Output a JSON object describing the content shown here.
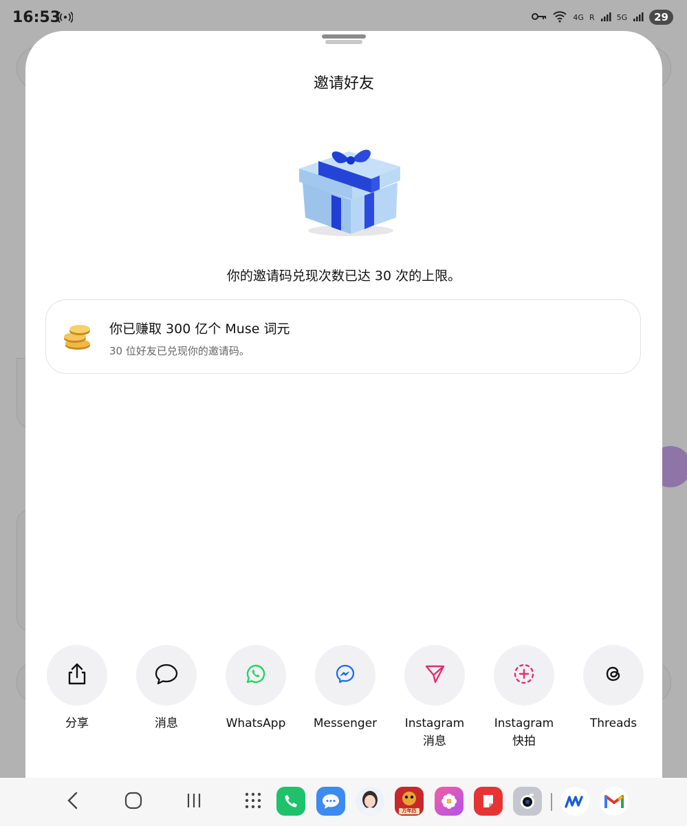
{
  "status_bar": {
    "time": "16:53",
    "network_4g": "4G",
    "roaming": "R",
    "network_5g": "5G",
    "battery": "29"
  },
  "sheet": {
    "title": "邀请好友",
    "limit_message": "你的邀请码兑现次数已达 30 次的上限。",
    "earn_card": {
      "title": "你已赚取 300 亿个 Muse 词元",
      "subtitle": "30 位好友已兑现你的邀请码。"
    }
  },
  "share_targets": [
    {
      "label": "分享",
      "icon": "share-icon"
    },
    {
      "label": "消息",
      "icon": "message-bubble-icon"
    },
    {
      "label": "WhatsApp",
      "icon": "whatsapp-icon"
    },
    {
      "label": "Messenger",
      "icon": "messenger-icon"
    },
    {
      "label": "Instagram\n消息",
      "icon": "instagram-direct-icon"
    },
    {
      "label": "Instagram\n快拍",
      "icon": "instagram-story-icon"
    },
    {
      "label": "Threads",
      "icon": "threads-icon"
    }
  ],
  "taskbar": {
    "nav_buttons": [
      "back-icon",
      "home-icon",
      "recents-icon",
      "app-drawer-icon"
    ],
    "dock_apps": [
      "phone-app-icon",
      "messages-app-icon",
      "avatar-app-icon",
      "calendar-app-icon",
      "gallery-app-icon",
      "notes-app-icon",
      "camera-app-icon",
      "muse-app-icon",
      "gmail-app-icon"
    ],
    "calendar_app_label": "万年历"
  },
  "colors": {
    "gift_box": "#a9cdf2",
    "gift_ribbon": "#1f3fd6",
    "whatsapp": "#25d366",
    "messenger": "#1a6cf0",
    "instagram": "#e1306c"
  }
}
